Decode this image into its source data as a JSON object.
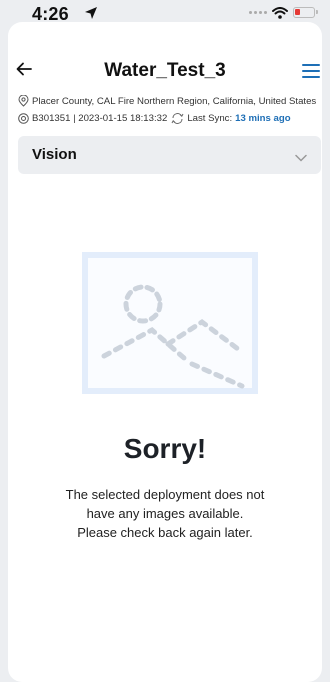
{
  "status_bar": {
    "time": "4:26",
    "icons": [
      "location-arrow-icon",
      "signal-icon",
      "wifi-icon",
      "battery-icon"
    ],
    "battery_color": "#e53935"
  },
  "header": {
    "title": "Water_Test_3",
    "back_icon": "arrow-left-icon",
    "menu_icon": "hamburger-menu-icon",
    "accent_color": "#1e6fb6"
  },
  "meta": {
    "location": "Placer County, CAL Fire Northern Region, California, United States",
    "device_info": "B301351 | 2023-01-15 18:13:32",
    "sync_label": "Last Sync:",
    "sync_value": "13 mins ago"
  },
  "dropdown": {
    "selected": "Vision",
    "icon": "chevron-down-icon"
  },
  "empty_state": {
    "icon": "image-placeholder-icon",
    "heading": "Sorry!",
    "message_lines": [
      "The selected deployment does not",
      "have any images available.",
      "Please check back again later."
    ]
  }
}
